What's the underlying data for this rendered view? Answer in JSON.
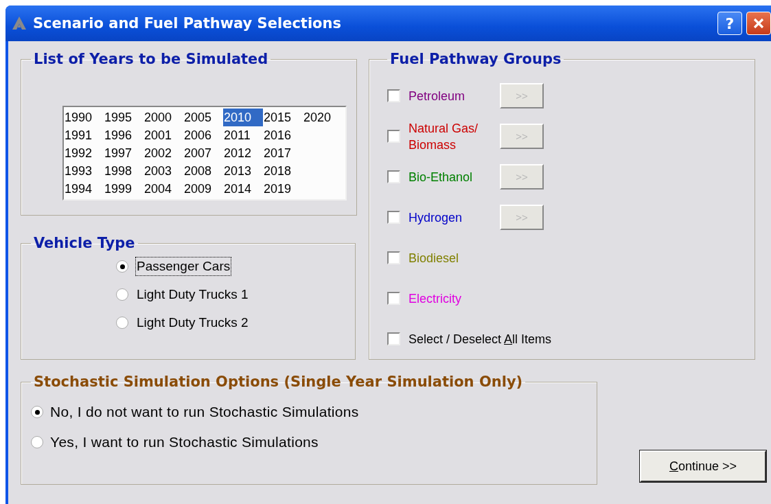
{
  "window": {
    "title": "Scenario and Fuel Pathway Selections",
    "buttons": [
      {
        "kind": "help",
        "label": "?"
      },
      {
        "kind": "close"
      }
    ]
  },
  "years_group": {
    "title": "List of Years to be Simulated",
    "years": [
      {
        "label": "1990",
        "selected": false
      },
      {
        "label": "1991",
        "selected": false
      },
      {
        "label": "1992",
        "selected": false
      },
      {
        "label": "1993",
        "selected": false
      },
      {
        "label": "1994",
        "selected": false
      },
      {
        "label": "1995",
        "selected": false
      },
      {
        "label": "1996",
        "selected": false
      },
      {
        "label": "1997",
        "selected": false
      },
      {
        "label": "1998",
        "selected": false
      },
      {
        "label": "1999",
        "selected": false
      },
      {
        "label": "2000",
        "selected": false
      },
      {
        "label": "2001",
        "selected": false
      },
      {
        "label": "2002",
        "selected": false
      },
      {
        "label": "2003",
        "selected": false
      },
      {
        "label": "2004",
        "selected": false
      },
      {
        "label": "2005",
        "selected": false
      },
      {
        "label": "2006",
        "selected": false
      },
      {
        "label": "2007",
        "selected": false
      },
      {
        "label": "2008",
        "selected": false
      },
      {
        "label": "2009",
        "selected": false
      },
      {
        "label": "2010",
        "selected": true
      },
      {
        "label": "2011",
        "selected": false
      },
      {
        "label": "2012",
        "selected": false
      },
      {
        "label": "2013",
        "selected": false
      },
      {
        "label": "2014",
        "selected": false
      },
      {
        "label": "2015",
        "selected": false
      },
      {
        "label": "2016",
        "selected": false
      },
      {
        "label": "2017",
        "selected": false
      },
      {
        "label": "2018",
        "selected": false
      },
      {
        "label": "2019",
        "selected": false
      },
      {
        "label": "2020",
        "selected": false
      }
    ]
  },
  "fuel_group": {
    "title": "Fuel Pathway Groups",
    "items": [
      {
        "label": "Petroleum",
        "color": "#800080",
        "checked": false,
        "button": {
          "label": ">>",
          "disabled": true
        }
      },
      {
        "label": "Natural Gas/\nBiomass",
        "color": "#cc0000",
        "checked": false,
        "button": {
          "label": ">>",
          "disabled": true
        }
      },
      {
        "label": "Bio-Ethanol",
        "color": "#008000",
        "checked": false,
        "button": {
          "label": ">>",
          "disabled": true
        }
      },
      {
        "label": "Hydrogen",
        "color": "#0000c8",
        "checked": false,
        "button": {
          "label": ">>",
          "disabled": true
        }
      },
      {
        "label": "Biodiesel",
        "color": "#808000",
        "checked": false
      },
      {
        "label": "Electricity",
        "color": "#e000e0",
        "checked": false
      },
      {
        "label": "Select / Deselect ",
        "mnemonic": "A",
        "label_after": "ll Items",
        "color": "#000000",
        "checked": false
      }
    ]
  },
  "vehicle_group": {
    "title": "Vehicle Type",
    "options": [
      {
        "label": "Passenger Cars",
        "selected": true,
        "focused": true
      },
      {
        "label": "Light Duty Trucks 1",
        "selected": false,
        "focused": false
      },
      {
        "label": "Light Duty Trucks 2",
        "selected": false,
        "focused": false
      }
    ]
  },
  "stochastic_group": {
    "title": "Stochastic Simulation Options (Single Year Simulation Only)",
    "options": [
      {
        "label": "No, I do not want to run Stochastic Simulations",
        "selected": true
      },
      {
        "label": "Yes, I want to run Stochastic Simulations",
        "selected": false
      }
    ]
  },
  "continue_button": {
    "mnemonic": "C",
    "label_after": "ontinue >>"
  }
}
